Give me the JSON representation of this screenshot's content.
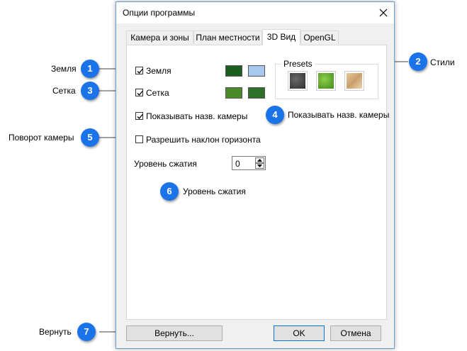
{
  "window": {
    "title": "Опции программы"
  },
  "tabs": [
    {
      "label": "Камера и зоны"
    },
    {
      "label": "План местности"
    },
    {
      "label": "3D Вид"
    },
    {
      "label": "OpenGL"
    }
  ],
  "options": {
    "ground": {
      "label": "Земля",
      "checked": true,
      "colors": [
        "#1b5e20",
        "#a9c8ee"
      ]
    },
    "grid": {
      "label": "Сетка",
      "checked": true,
      "colors": [
        "#4a8a2a",
        "#2e6f2a"
      ]
    },
    "camera_names": {
      "label": "Показывать назв. камеры",
      "checked": true
    },
    "horizon_tilt": {
      "label": "Разрешить наклон горизонта",
      "checked": false
    }
  },
  "presets": {
    "title": "Presets",
    "items": [
      {
        "name": "dark-metal-preset"
      },
      {
        "name": "grass-preset"
      },
      {
        "name": "sand-preset"
      }
    ]
  },
  "compression": {
    "label": "Уровень сжатия",
    "value": "0"
  },
  "buttons": {
    "revert": "Вернуть...",
    "ok": "OK",
    "cancel": "Отмена"
  },
  "callouts": [
    {
      "number": "1",
      "text": "Земля"
    },
    {
      "number": "2",
      "text": "Стили"
    },
    {
      "number": "3",
      "text": "Сетка"
    },
    {
      "number": "4",
      "text": "Показывать назв. камеры"
    },
    {
      "number": "5",
      "text": "Поворот камеры"
    },
    {
      "number": "6",
      "text": "Уровень сжатия"
    },
    {
      "number": "7",
      "text": "Вернуть"
    }
  ],
  "colors": {
    "badge": "#1a73e8",
    "accent": "#0078d7"
  }
}
